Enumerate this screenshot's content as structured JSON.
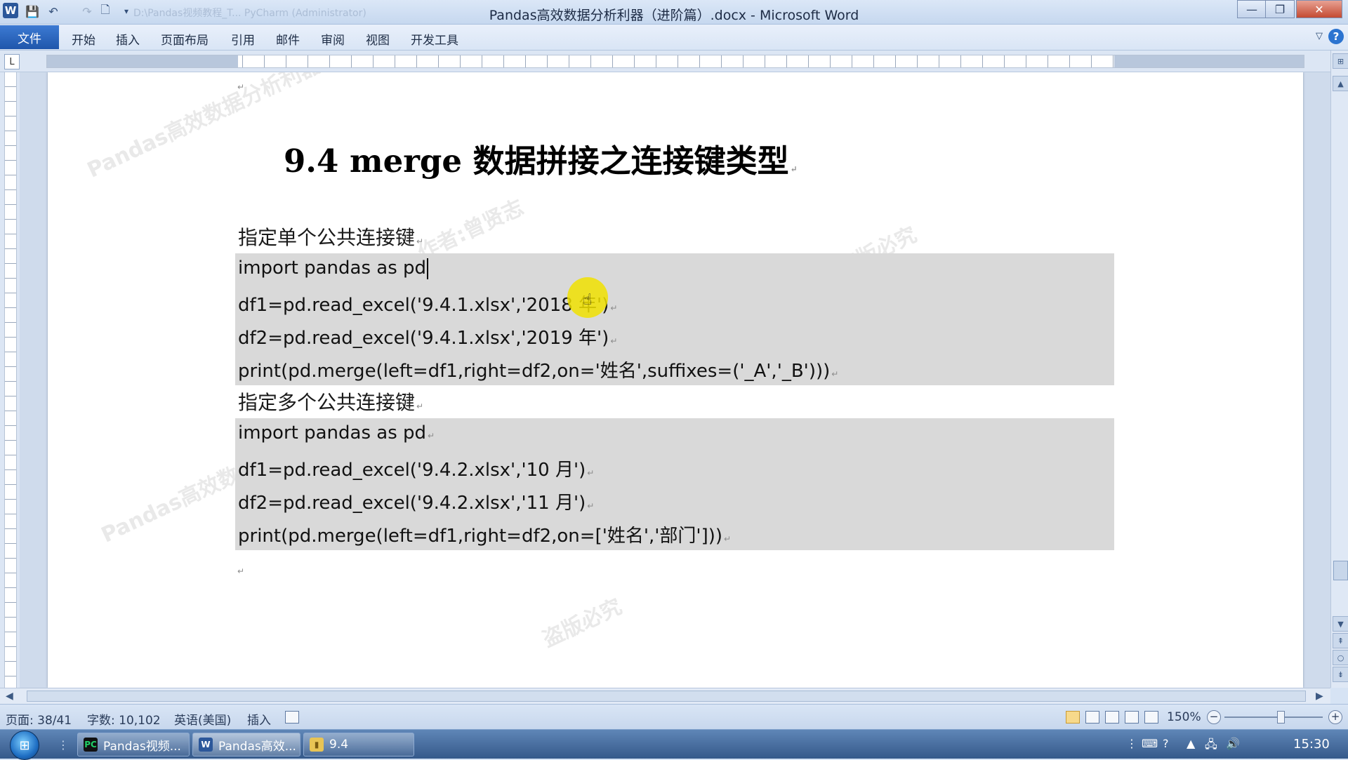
{
  "window": {
    "title": "Pandas高效数据分析利器（进阶篇）.docx - Microsoft Word",
    "faded_title": "D:\\Pandas视频教程_T... PyCharm (Administrator)",
    "minimize": "—",
    "restore": "❐",
    "close": "✕"
  },
  "ribbon": {
    "file_tab": "文件",
    "tabs": [
      "开始",
      "插入",
      "页面布局",
      "引用",
      "邮件",
      "审阅",
      "视图",
      "开发工具"
    ],
    "help": "?"
  },
  "document": {
    "heading": "9.4 merge 数据拼接之连接键类型",
    "section1_label": "指定单个公共连接键",
    "block1": [
      "import pandas as pd",
      "df1=pd.read_excel('9.4.1.xlsx','2018 年')",
      "df2=pd.read_excel('9.4.1.xlsx','2019 年')",
      "print(pd.merge(left=df1,right=df2,on='姓名',suffixes=('_A','_B')))"
    ],
    "section2_label": "指定多个公共连接键",
    "block2": [
      "import pandas as pd",
      "df1=pd.read_excel('9.4.2.xlsx','10 月')",
      "df2=pd.read_excel('9.4.2.xlsx','11 月')",
      "print(pd.merge(left=df1,right=df2,on=['姓名','部门']))"
    ],
    "watermark_lines": [
      "Pandas高效数据分析利器",
      "作者:曾贤志",
      "盗版必究"
    ]
  },
  "statusbar": {
    "page": "页面: 38/41",
    "words": "字数: 10,102",
    "language": "英语(美国)",
    "mode": "插入",
    "zoom": "150%"
  },
  "taskbar": {
    "items": [
      {
        "label": "Pandas视频...",
        "icon": "pycharm-icon"
      },
      {
        "label": "Pandas高效...",
        "icon": "word-icon"
      },
      {
        "label": "9.4",
        "icon": "folder-icon"
      }
    ],
    "clock": "15:30"
  },
  "colors": {
    "code_background": "#d9d9d9",
    "cursor_highlight": "#f0e100",
    "file_tab": "#2b5fb0"
  }
}
